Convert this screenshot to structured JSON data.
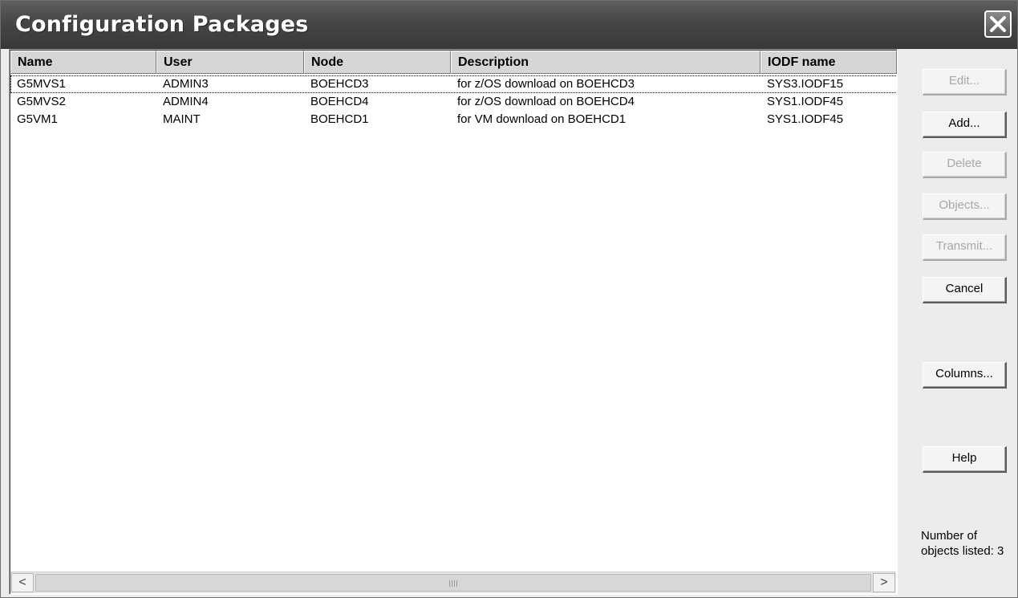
{
  "window": {
    "title": "Configuration Packages"
  },
  "list": {
    "columns": [
      "Name",
      "User",
      "Node",
      "Description",
      "IODF name"
    ],
    "rows": [
      [
        "G5MVS1",
        "ADMIN3",
        "BOEHCD3",
        "for z/OS download on BOEHCD3",
        "SYS3.IODF15"
      ],
      [
        "G5MVS2",
        "ADMIN4",
        "BOEHCD4",
        "for z/OS download on BOEHCD4",
        "SYS1.IODF45"
      ],
      [
        "G5VM1",
        "MAINT",
        "BOEHCD1",
        "for VM download on BOEHCD1",
        "SYS1.IODF45"
      ]
    ],
    "selected_row": 0
  },
  "scrollbar": {
    "left_arrow": "<",
    "right_arrow": ">"
  },
  "buttons": {
    "edit": "Edit...",
    "add": "Add...",
    "delete": "Delete",
    "objects": "Objects...",
    "transmit": "Transmit...",
    "cancel": "Cancel",
    "columns": "Columns...",
    "help": "Help"
  },
  "disabled_buttons": [
    "edit",
    "delete",
    "objects",
    "transmit"
  ],
  "status": {
    "count_text": "Number of objects listed: 3"
  },
  "icons": {
    "close": "close-icon"
  }
}
